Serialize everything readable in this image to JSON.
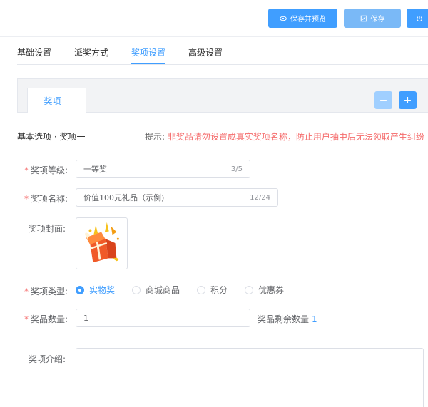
{
  "toolbar": {
    "save_preview_label": "保存并预览",
    "save_label": "保存"
  },
  "tabs": [
    {
      "label": "基础设置",
      "active": false
    },
    {
      "label": "派奖方式",
      "active": false
    },
    {
      "label": "奖项设置",
      "active": true
    },
    {
      "label": "高级设置",
      "active": false
    }
  ],
  "prize_tabs": {
    "current": "奖项一",
    "remove_glyph": "−",
    "add_glyph": "+"
  },
  "section": {
    "title": "基本选项 · 奖项一",
    "tip_label": "提示:",
    "tip_text": "非奖品请勿设置成真实奖项名称，防止用户抽中后无法领取产生纠纷"
  },
  "form": {
    "level": {
      "label": "奖项等级:",
      "value": "一等奖",
      "count": "3/5",
      "required": true
    },
    "name": {
      "label": "奖项名称:",
      "value": "价值100元礼品（示例)",
      "count": "12/24",
      "required": true
    },
    "cover": {
      "label": "奖项封面:"
    },
    "type": {
      "label": "奖项类型:",
      "required": true,
      "options": [
        "实物奖",
        "商城商品",
        "积分",
        "优惠券"
      ],
      "selected": "实物奖"
    },
    "quantity": {
      "label": "奖品数量:",
      "value": "1",
      "required": true,
      "remain_label": "奖品剩余数量",
      "remain_value": "1"
    },
    "intro": {
      "label": "奖项介绍:"
    }
  },
  "colors": {
    "primary": "#409eff",
    "danger": "#f56c6c"
  }
}
